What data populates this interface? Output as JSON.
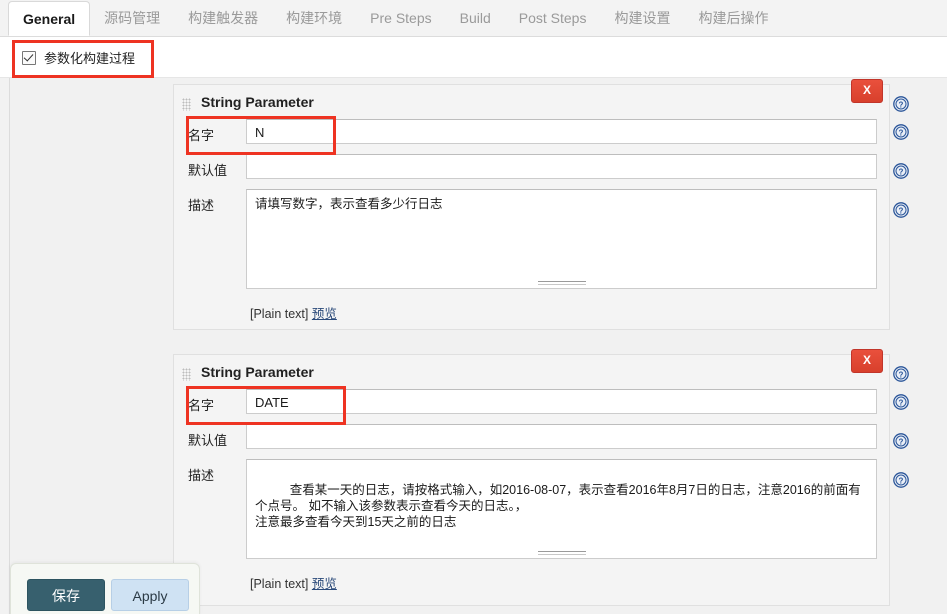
{
  "tabs": [
    {
      "label": "General",
      "active": true
    },
    {
      "label": "源码管理",
      "active": false
    },
    {
      "label": "构建触发器",
      "active": false
    },
    {
      "label": "构建环境",
      "active": false
    },
    {
      "label": "Pre Steps",
      "active": false
    },
    {
      "label": "Build",
      "active": false
    },
    {
      "label": "Post Steps",
      "active": false
    },
    {
      "label": "构建设置",
      "active": false
    },
    {
      "label": "构建后操作",
      "active": false
    }
  ],
  "config": {
    "parameterized_checkbox_label": "参数化构建过程",
    "parameterized_checked": true
  },
  "labels": {
    "name": "名字",
    "default_value": "默认值",
    "description": "描述",
    "plain_text": "[Plain text]",
    "preview": "预览",
    "delete": "X"
  },
  "parameters": [
    {
      "title": "String Parameter",
      "name_value": "N",
      "default_value": "",
      "description_value": "请填写数字，表示查看多少行日志"
    },
    {
      "title": "String Parameter",
      "name_value": "DATE",
      "default_value": "",
      "description_value": "查看某一天的日志，请按格式输入，如2016-08-07，表示查看2016年8月7日的日志，注意2016的前面有个点号。 如不输入该参数表示查看今天的日志。，\n注意最多查看今天到15天之前的日志"
    }
  ],
  "footer": {
    "save_label": "保存",
    "apply_label": "Apply"
  },
  "icons": {
    "help": "help-circle-icon",
    "grip": "drag-grip-icon"
  },
  "colors": {
    "accent_red": "#ee3322",
    "delete_button": "#d8402c",
    "help_blue": "#2a5599",
    "save_button": "#37606e",
    "apply_button": "#cfe2f3"
  }
}
